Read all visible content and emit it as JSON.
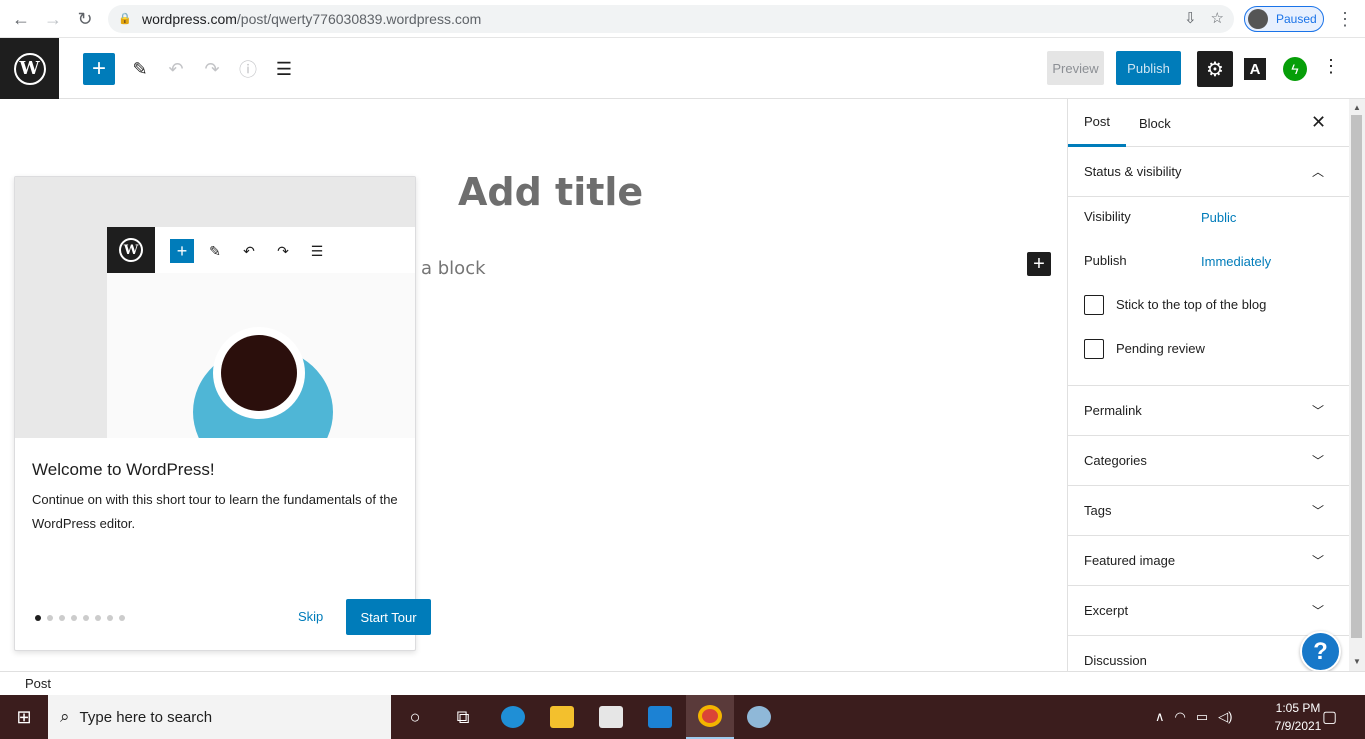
{
  "browser": {
    "url_host": "wordpress.com",
    "url_path": "/post/qwerty776030839.wordpress.com",
    "profile_status": "Paused"
  },
  "header": {
    "preview_label": "Preview",
    "publish_label": "Publish",
    "a_label": "A"
  },
  "editor": {
    "title_placeholder": "Add title",
    "block_placeholder": "a block"
  },
  "guide": {
    "title": "Welcome to WordPress!",
    "text": "Continue on with this short tour to learn the fundamentals of the WordPress editor.",
    "skip_label": "Skip",
    "start_label": "Start Tour",
    "page_count": 8,
    "active_page": 1
  },
  "sidebar": {
    "tabs": [
      "Post",
      "Block"
    ],
    "active_tab": "Post",
    "status_panel": {
      "title": "Status & visibility",
      "visibility_label": "Visibility",
      "visibility_value": "Public",
      "publish_label": "Publish",
      "publish_value": "Immediately",
      "stick_label": "Stick to the top of the blog",
      "pending_label": "Pending review"
    },
    "panels": [
      "Permalink",
      "Categories",
      "Tags",
      "Featured image",
      "Excerpt",
      "Discussion"
    ]
  },
  "footer": {
    "breadcrumb": "Post"
  },
  "taskbar": {
    "search_placeholder": "Type here to search",
    "time": "1:05 PM",
    "date": "7/9/2021"
  },
  "colors": {
    "accent": "#007cba",
    "dark": "#1e1e1e",
    "jetpack": "#069e08",
    "taskbar": "#3b1d1d"
  }
}
